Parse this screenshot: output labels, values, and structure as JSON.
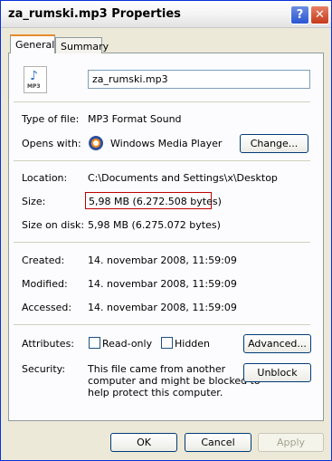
{
  "window": {
    "title": "za_rumski.mp3 Properties",
    "help_glyph": "?",
    "close_glyph": "✕"
  },
  "tabs": [
    {
      "label": "General",
      "active": true
    },
    {
      "label": "Summary",
      "active": false
    }
  ],
  "file": {
    "icon_caption": "MP3",
    "name": "za_rumski.mp3"
  },
  "props": {
    "type_label": "Type of file:",
    "type_value": "MP3 Format Sound",
    "opens_label": "Opens with:",
    "opens_value": "Windows Media Player",
    "change_button": "Change...",
    "location_label": "Location:",
    "location_value": "C:\\Documents and Settings\\x\\Desktop",
    "size_label": "Size:",
    "size_value": "5,98 MB (6.272.508 bytes)",
    "size_disk_label": "Size on disk:",
    "size_disk_value": "5,98 MB (6.275.072 bytes)",
    "created_label": "Created:",
    "created_value": "14. novembar 2008, 11:59:09",
    "modified_label": "Modified:",
    "modified_value": "14. novembar 2008, 11:59:09",
    "accessed_label": "Accessed:",
    "accessed_value": "14. novembar 2008, 11:59:09",
    "attributes_label": "Attributes:",
    "readonly_label": "Read-only",
    "readonly_checked": false,
    "hidden_label": "Hidden",
    "hidden_checked": false,
    "advanced_button": "Advanced...",
    "security_label": "Security:",
    "security_line1": "This file came from another",
    "security_line2": "computer and might be blocked to",
    "security_line3": "help protect this computer.",
    "unblock_button": "Unblock"
  },
  "footer": {
    "ok": "OK",
    "cancel": "Cancel",
    "apply": "Apply"
  },
  "colors": {
    "highlight_border": "#c00000",
    "active_tab_accent": "#e68b2c"
  }
}
